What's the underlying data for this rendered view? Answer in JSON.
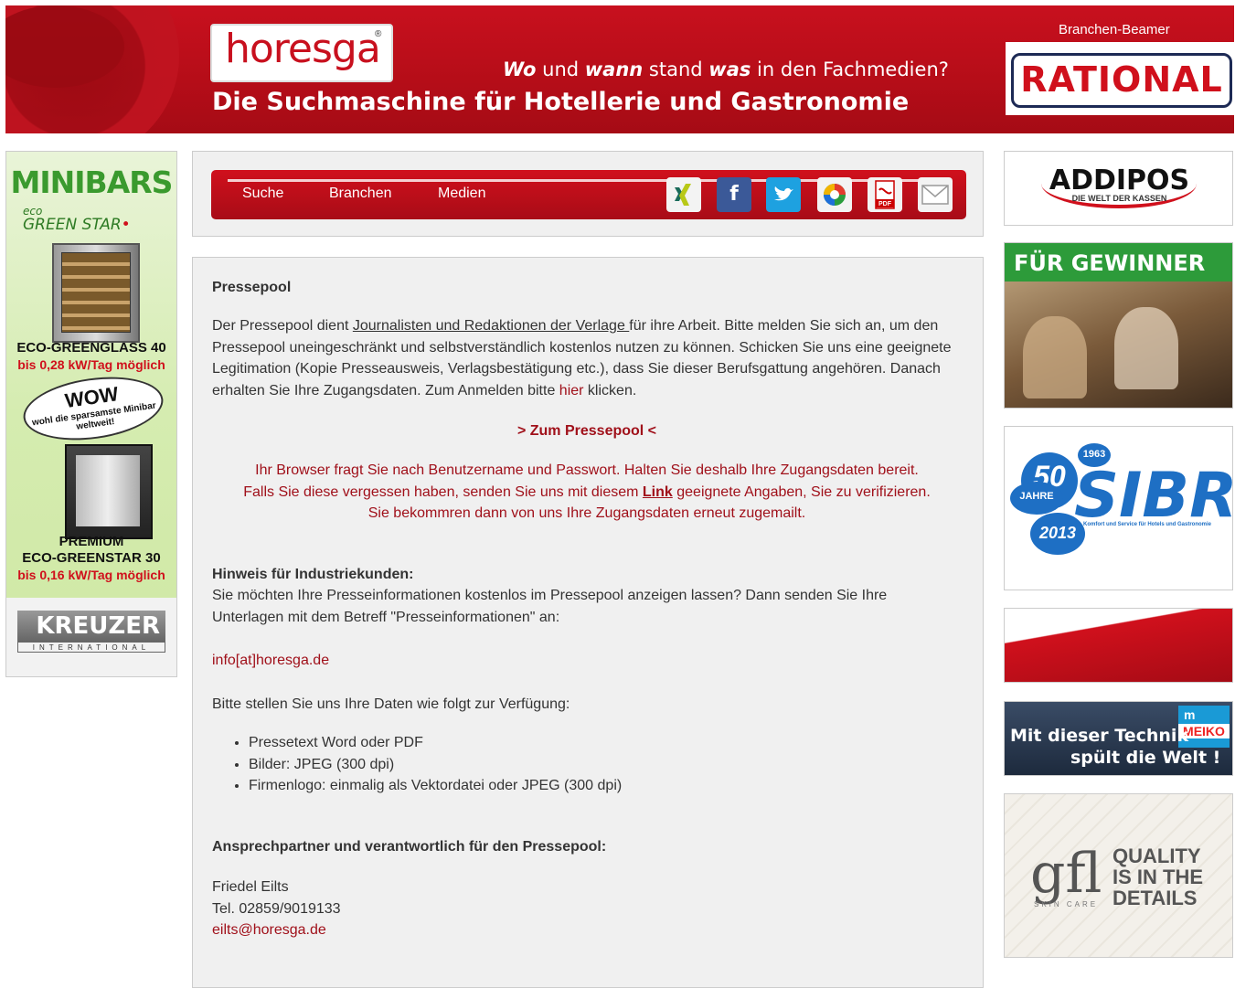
{
  "header": {
    "logo_text": "horesga",
    "logo_reg": "®",
    "tagline_w1": "Wo",
    "tagline_t1": " und ",
    "tagline_w2": "wann",
    "tagline_t2": " stand ",
    "tagline_w3": "was",
    "tagline_t3": " in den Fachmedien?",
    "headline": "Die Suchmaschine für Hotellerie und Gastronomie",
    "beamer_label": "Branchen-Beamer",
    "beamer_brand": "RATIONAL"
  },
  "nav": {
    "links": [
      {
        "label": "Suche"
      },
      {
        "label": "Branchen"
      },
      {
        "label": "Medien"
      }
    ],
    "share_icons": [
      "xing-icon",
      "facebook-icon",
      "twitter-icon",
      "google-buzz-icon",
      "pdf-icon",
      "email-icon"
    ],
    "pdf_label": "PDF"
  },
  "left_ad": {
    "title": "MINIBARS",
    "eco_line": "GREEN STAR",
    "eco_prefix": "eco",
    "product1": "ECO-GREENGLASS 40",
    "product1_sub": "bis 0,28 kW/Tag möglich",
    "wow": "WOW",
    "wow_sub": "wohl die sparsamste Minibar weltweit!",
    "product2_a": "PREMIUM",
    "product2_b": "ECO-GREENSTAR 30",
    "product2_sub": "bis 0,16 kW/Tag möglich",
    "brand": "KREUZER",
    "brand_sub": "INTERNATIONAL"
  },
  "content": {
    "title": "Pressepool",
    "p1_a": "Der Pressepool dient ",
    "p1_link": "Journalisten und Redaktionen der Verlage ",
    "p1_b": " für ihre Arbeit. Bitte melden Sie sich an, um den Pressepool uneingeschränkt und selbstverständlich kostenlos nutzen zu können. Schicken Sie uns eine geeignete Legitimation (Kopie Presseausweis, Verlagsbestätigung etc.), dass Sie dieser Berufsgattung angehören. Danach erhalten Sie Ihre Zugangsdaten. Zum Anmelden bitte ",
    "p1_here": "hier",
    "p1_c": " klicken.",
    "pool_link": "> Zum Pressepool <",
    "browser_line1": "Ihr Browser fragt Sie nach Benutzername und Passwort. Halten Sie deshalb Ihre Zugangsdaten bereit.",
    "browser_line2a": "Falls Sie diese vergessen haben, senden Sie uns mit diesem ",
    "browser_link": "Link",
    "browser_line2b": " geeignete Angaben, Sie zu verifizieren.",
    "browser_line3": "Sie bekommren dann von uns Ihre Zugangsdaten erneut zugemailt.",
    "hint_title": "Hinweis für Industriekunden:",
    "hint_text": "Sie möchten Ihre Presseinformationen kostenlos im Pressepool anzeigen lassen? Dann senden Sie Ihre Unterlagen mit dem Betreff \"Presseinformationen\" an:",
    "email1": "info[at]horesga.de",
    "data_intro": "Bitte stellen Sie uns Ihre Daten wie folgt zur Verfügung:",
    "list": [
      "Pressetext Word oder PDF",
      "Bilder: JPEG (300 dpi)",
      "Firmenlogo: einmalig als Vektordatei oder JPEG (300 dpi)"
    ],
    "contact_title": "Ansprechpartner und verantwortlich für den Pressepool:",
    "contact_name": "Friedel Eilts",
    "contact_tel": "Tel. 02859/9019133",
    "contact_email": "eilts@horesga.de"
  },
  "right_ads": {
    "addipos": "ADDIPOS",
    "addipos_sub": "DIE WELT DER KASSEN",
    "gewinner": "FÜR GEWINNER",
    "sibra": "SIBRA",
    "sibra_50": "50",
    "sibra_jahre": "JAHRE",
    "sibra_2013": "2013",
    "sibra_1963": "1963",
    "sibra_sub": "Komfort und Service für Hotels und Gastronomie",
    "meiko_line1": "Mit dieser Technik",
    "meiko_line2": "spült die Welt !",
    "meiko_brand": "MEIKO",
    "meiko_m": "m",
    "gfl": "gfl",
    "gfl_sub": "SKIN CARE",
    "gfl_claim_1": "QUALITY",
    "gfl_claim_2": "IS IN THE",
    "gfl_claim_3": "DETAILS"
  }
}
